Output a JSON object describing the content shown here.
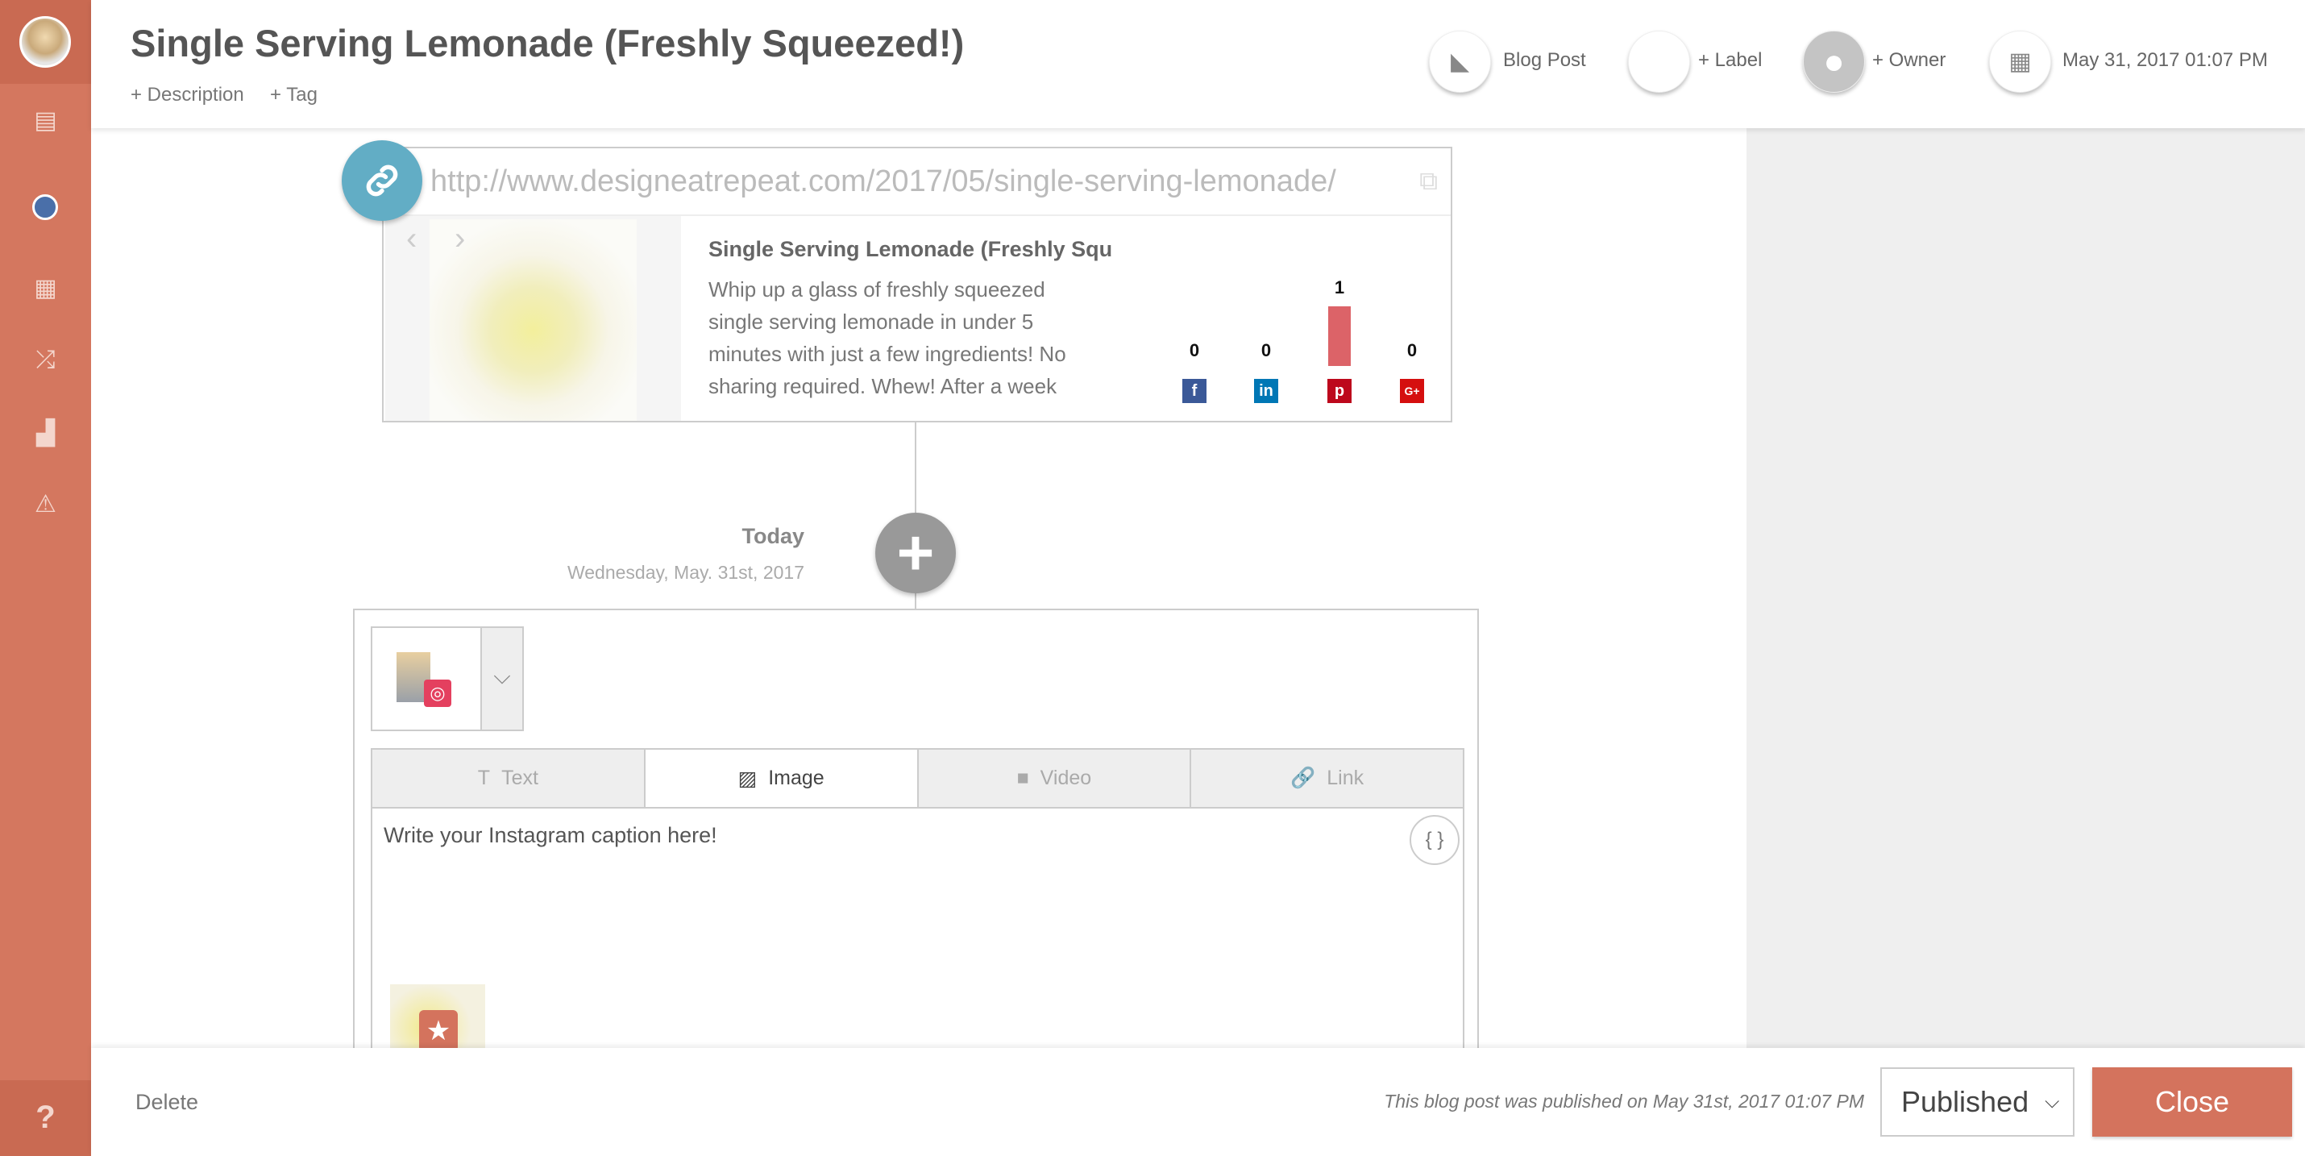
{
  "header": {
    "title": "Single Serving Lemonade (Freshly Squeezed!)",
    "add_description": "+ Description",
    "add_tag": "+ Tag",
    "type_label": "Blog Post",
    "label_label": "+ Label",
    "owner_label": "+ Owner",
    "date_label": "May 31, 2017 01:07 PM"
  },
  "link_card": {
    "url": "http://www.designeatrepeat.com/2017/05/single-serving-lemonade/",
    "title": "Single Serving Lemonade (Freshly Squeezed!)",
    "description_lines": [
      "Whip up a glass of freshly squeezed",
      "single serving lemonade in under 5",
      "minutes with just a few ingredients! No",
      "sharing required. Whew! After a week"
    ],
    "shares": [
      {
        "network": "facebook",
        "count": "0",
        "color": "#3b5998"
      },
      {
        "network": "linkedin",
        "count": "0",
        "color": "#0077b5"
      },
      {
        "network": "pinterest",
        "count": "1",
        "color": "#bd081c"
      },
      {
        "network": "google-plus",
        "count": "0",
        "color": "#d50f0f"
      }
    ],
    "bar_color": "#dc6368"
  },
  "timeline": {
    "day": "Today",
    "date": "Wednesday, May. 31st, 2017"
  },
  "post": {
    "tabs": [
      {
        "label": "Text",
        "icon": "T"
      },
      {
        "label": "Image",
        "icon": "▨"
      },
      {
        "label": "Video",
        "icon": "■"
      },
      {
        "label": "Link",
        "icon": "🔗"
      }
    ],
    "active_tab": "Image",
    "caption": "Write your Instagram caption here!",
    "braces": "{ }"
  },
  "footer": {
    "delete": "Delete",
    "status": "This blog post was published on May 31st, 2017 01:07 PM",
    "select_value": "Published",
    "close": "Close"
  },
  "sidebar": {
    "help": "?"
  },
  "colors": {
    "sidebar": "#d4775f",
    "accent": "#d4735d",
    "link": "#62adc5"
  }
}
